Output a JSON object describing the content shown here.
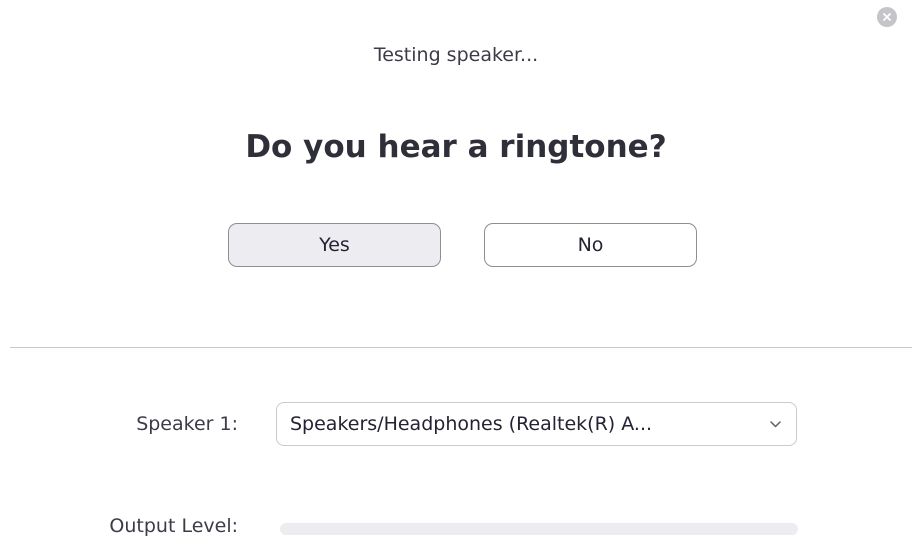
{
  "dialog": {
    "status_text": "Testing speaker...",
    "question": "Do you hear a ringtone?"
  },
  "actions": {
    "yes_label": "Yes",
    "no_label": "No"
  },
  "speaker": {
    "label": "Speaker 1:",
    "selected_device": "Speakers/Headphones (Realtek(R) A..."
  },
  "output": {
    "label": "Output Level:",
    "level": 0
  },
  "icons": {
    "close": "close-icon",
    "dropdown": "chevron-down-icon"
  },
  "colors": {
    "selected_button_bg": "#ececf1",
    "meter_track": "#ededf1",
    "meter_fill": "#2d8cff"
  }
}
